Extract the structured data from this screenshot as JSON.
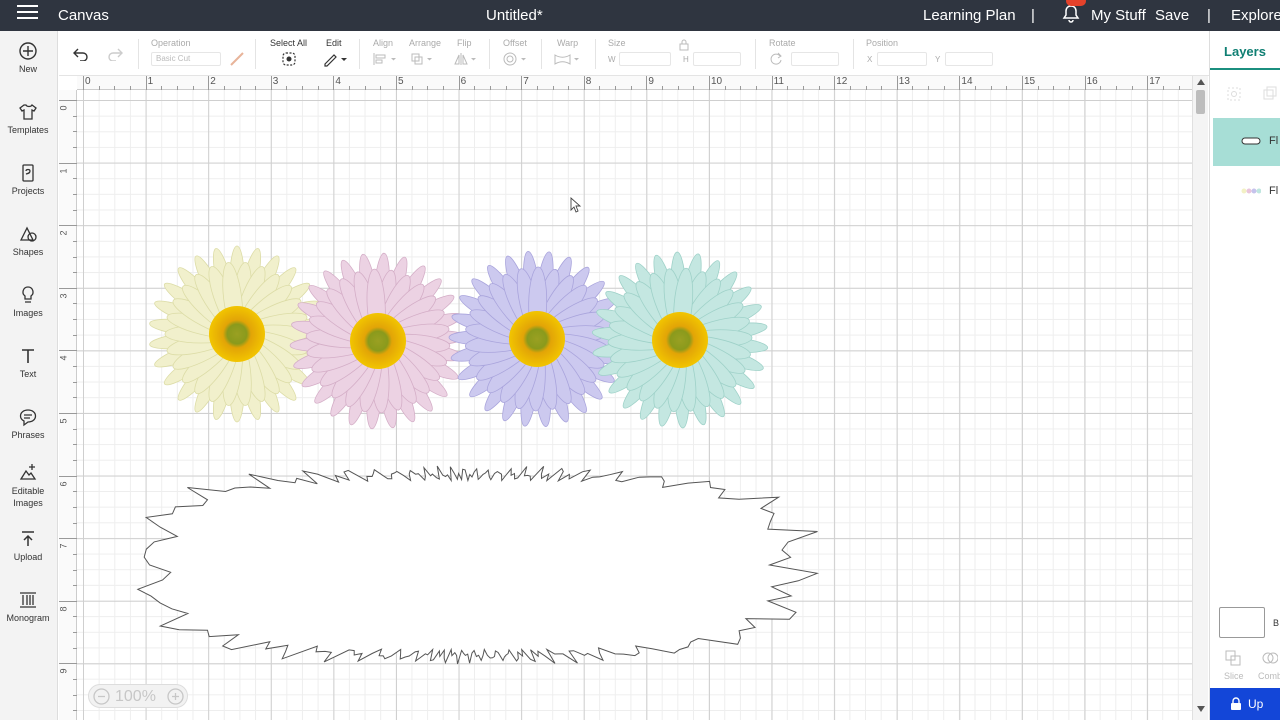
{
  "header": {
    "app": "Canvas",
    "title": "Untitled*",
    "learning": "Learning Plan",
    "sep1": "|",
    "mystuff": "My Stuff",
    "save": "Save",
    "sep2": "|",
    "explore": "Explore"
  },
  "nav": [
    {
      "label": "New",
      "icon": "plus-circle-icon"
    },
    {
      "label": "Templates",
      "icon": "tshirt-icon"
    },
    {
      "label": "Projects",
      "icon": "projects-icon"
    },
    {
      "label": "Shapes",
      "icon": "shapes-icon"
    },
    {
      "label": "Images",
      "icon": "lightbulb-icon"
    },
    {
      "label": "Text",
      "icon": "text-icon"
    },
    {
      "label": "Phrases",
      "icon": "speech-bubble-icon"
    },
    {
      "label": "Editable Images",
      "icon": "editable-images-icon"
    },
    {
      "label": "Upload",
      "icon": "upload-icon"
    },
    {
      "label": "Monogram",
      "icon": "monogram-icon"
    }
  ],
  "toolbar": {
    "operation": "Operation",
    "operation_value": "Basic Cut",
    "select_all": "Select All",
    "edit": "Edit",
    "align": "Align",
    "arrange": "Arrange",
    "flip": "Flip",
    "offset": "Offset",
    "warp": "Warp",
    "size": "Size",
    "w": "W",
    "h": "H",
    "rotate": "Rotate",
    "position": "Position",
    "x": "X",
    "y": "Y"
  },
  "ruler": {
    "top": [
      "0",
      "1",
      "2",
      "3",
      "4",
      "5",
      "6",
      "7",
      "8",
      "9",
      "10",
      "11",
      "12",
      "13",
      "14",
      "15",
      "16",
      "17"
    ],
    "left": [
      "0",
      "1",
      "2",
      "3",
      "4",
      "5",
      "6",
      "7",
      "8",
      "9"
    ]
  },
  "layers": {
    "tab": "Layers",
    "items": [
      "Fl",
      "Fl"
    ],
    "blank_label": "B",
    "slice": "Slice",
    "combine": "Comb"
  },
  "zoom": "100%",
  "upload_btn": "Up",
  "colors": {
    "topbar": "#2f3540",
    "accent": "#1b8f7f",
    "upload": "#1346d8",
    "badge": "#e4422b"
  }
}
